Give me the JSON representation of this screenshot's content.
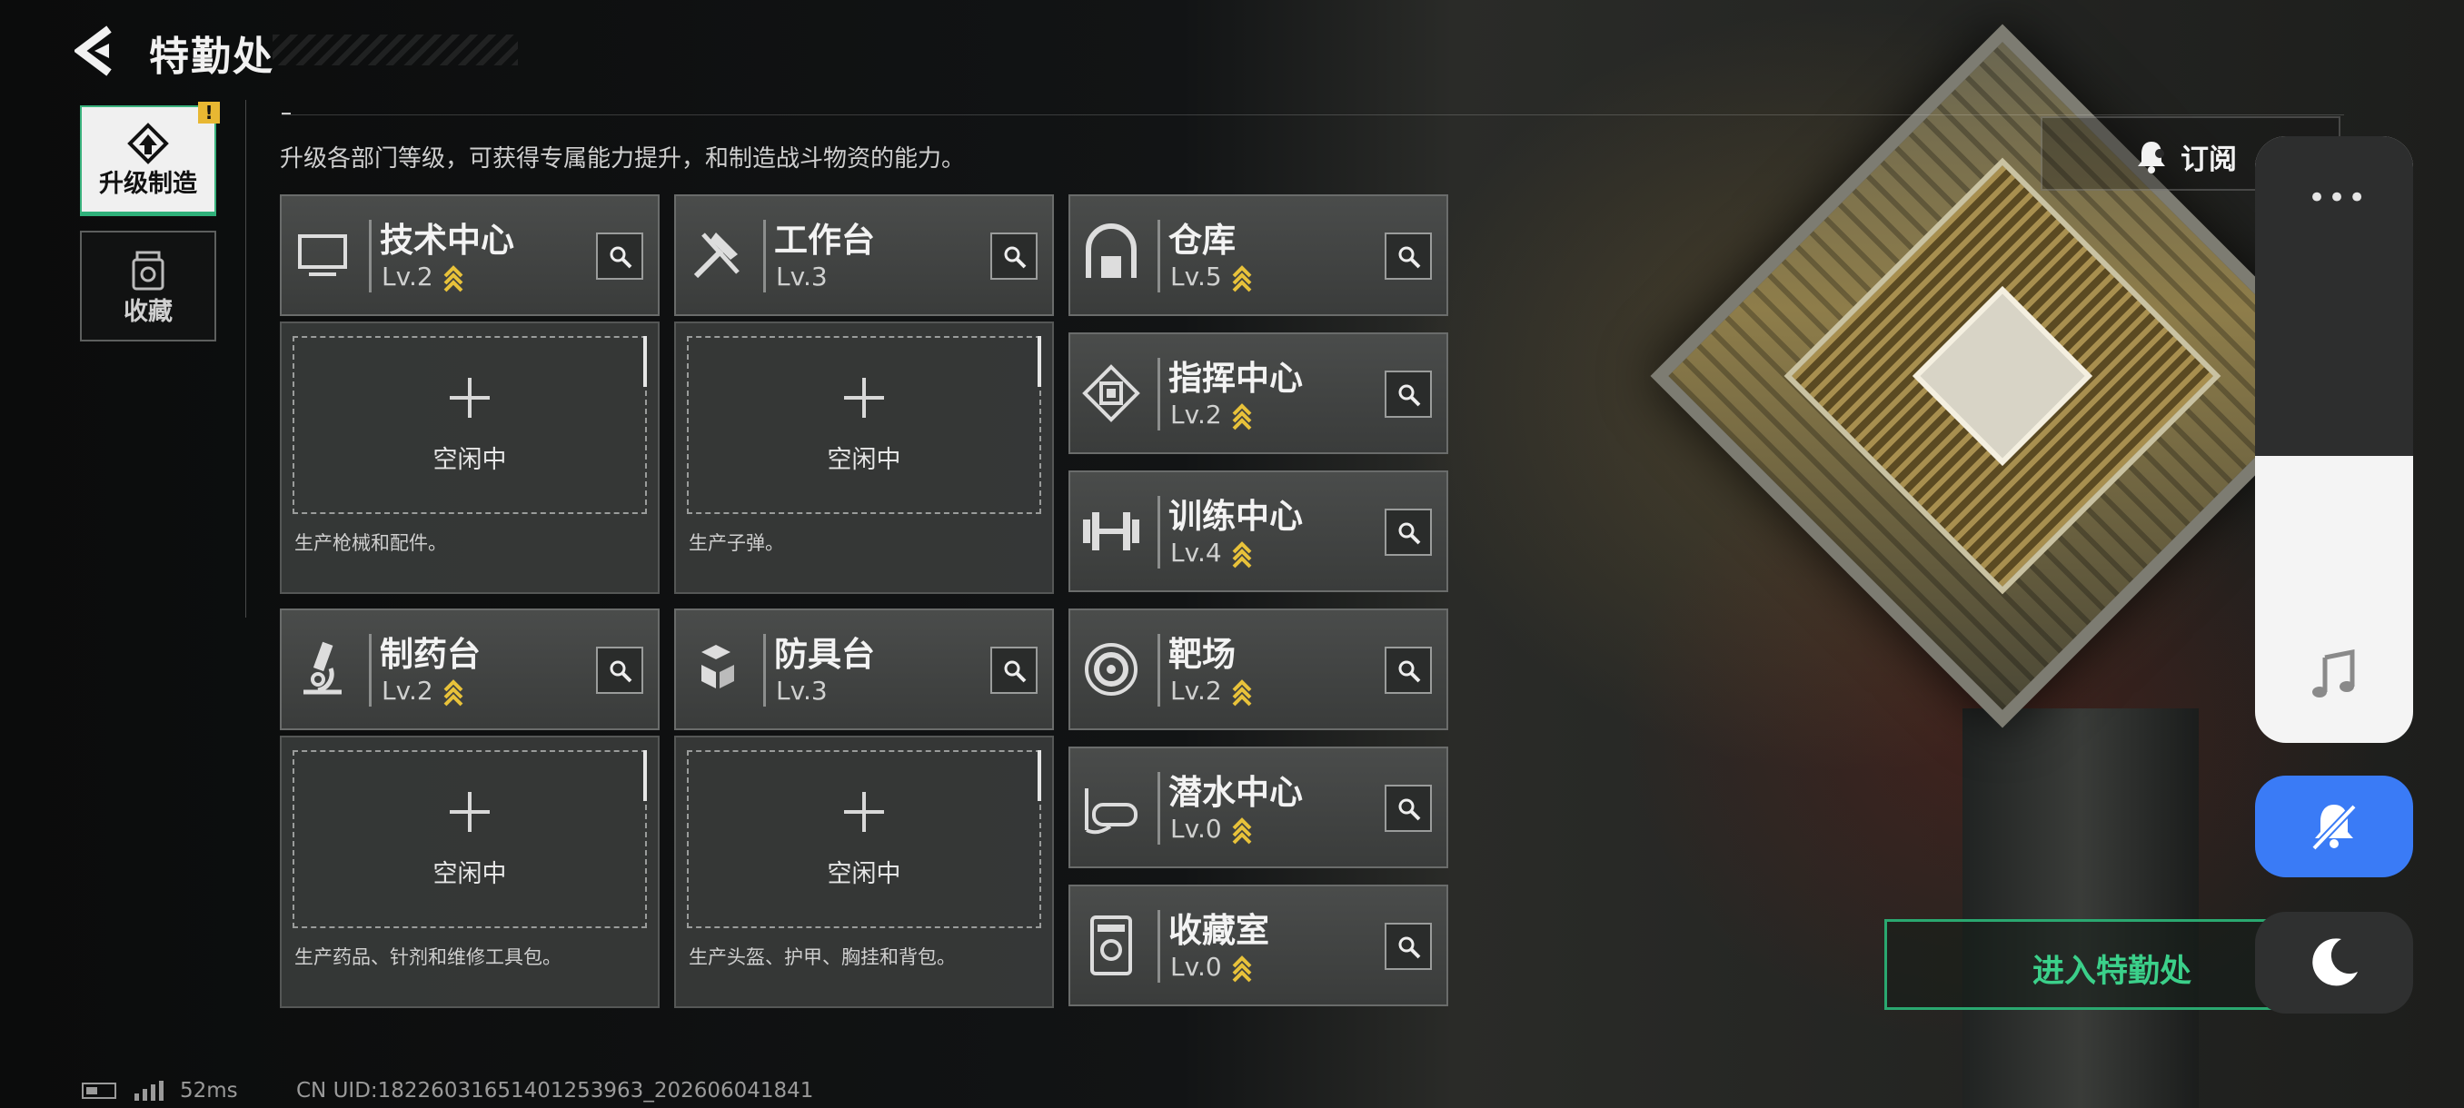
{
  "header": {
    "title": "特勤处"
  },
  "side_nav": {
    "upgrade_label": "升级制造",
    "upgrade_badge": "!",
    "collection_label": "收藏"
  },
  "description": "升级各部门等级，可获得专属能力提升，和制造战斗物资的能力。",
  "subscribe_label": "订阅",
  "departments": [
    {
      "name": "技术中心",
      "level": "Lv.2",
      "icon": "monitor-icon",
      "upgradable": true
    },
    {
      "name": "工作台",
      "level": "Lv.3",
      "icon": "tools-icon",
      "upgradable": false
    },
    {
      "name": "仓库",
      "level": "Lv.5",
      "icon": "warehouse-icon",
      "upgradable": true
    },
    {
      "name": "指挥中心",
      "level": "Lv.2",
      "icon": "chip-icon",
      "upgradable": true
    },
    {
      "name": "训练中心",
      "level": "Lv.4",
      "icon": "dumbbell-icon",
      "upgradable": true
    },
    {
      "name": "制药台",
      "level": "Lv.2",
      "icon": "microscope-icon",
      "upgradable": true
    },
    {
      "name": "防具台",
      "level": "Lv.3",
      "icon": "cubes-icon",
      "upgradable": false
    },
    {
      "name": "靶场",
      "level": "Lv.2",
      "icon": "target-icon",
      "upgradable": true
    },
    {
      "name": "潜水中心",
      "level": "Lv.0",
      "icon": "diving-mask-icon",
      "upgradable": true
    },
    {
      "name": "收藏室",
      "level": "Lv.0",
      "icon": "collection-icon",
      "upgradable": true
    }
  ],
  "production": [
    {
      "status": "空闲中",
      "description": "生产枪械和配件。"
    },
    {
      "status": "空闲中",
      "description": "生产子弹。"
    },
    {
      "status": "空闲中",
      "description": "生产药品、针剂和维修工具包。"
    },
    {
      "status": "空闲中",
      "description": "生产头盔、护甲、胸挂和背包。"
    }
  ],
  "enter_button": "进入特勤处",
  "status_bar": {
    "latency": "52ms",
    "uid": "CN UID:18226031651401253963_202606041841"
  },
  "colors": {
    "accent_green": "#2fb07a",
    "upgrade_gold": "#e8c23a",
    "mute_blue": "#3a7bf6"
  }
}
